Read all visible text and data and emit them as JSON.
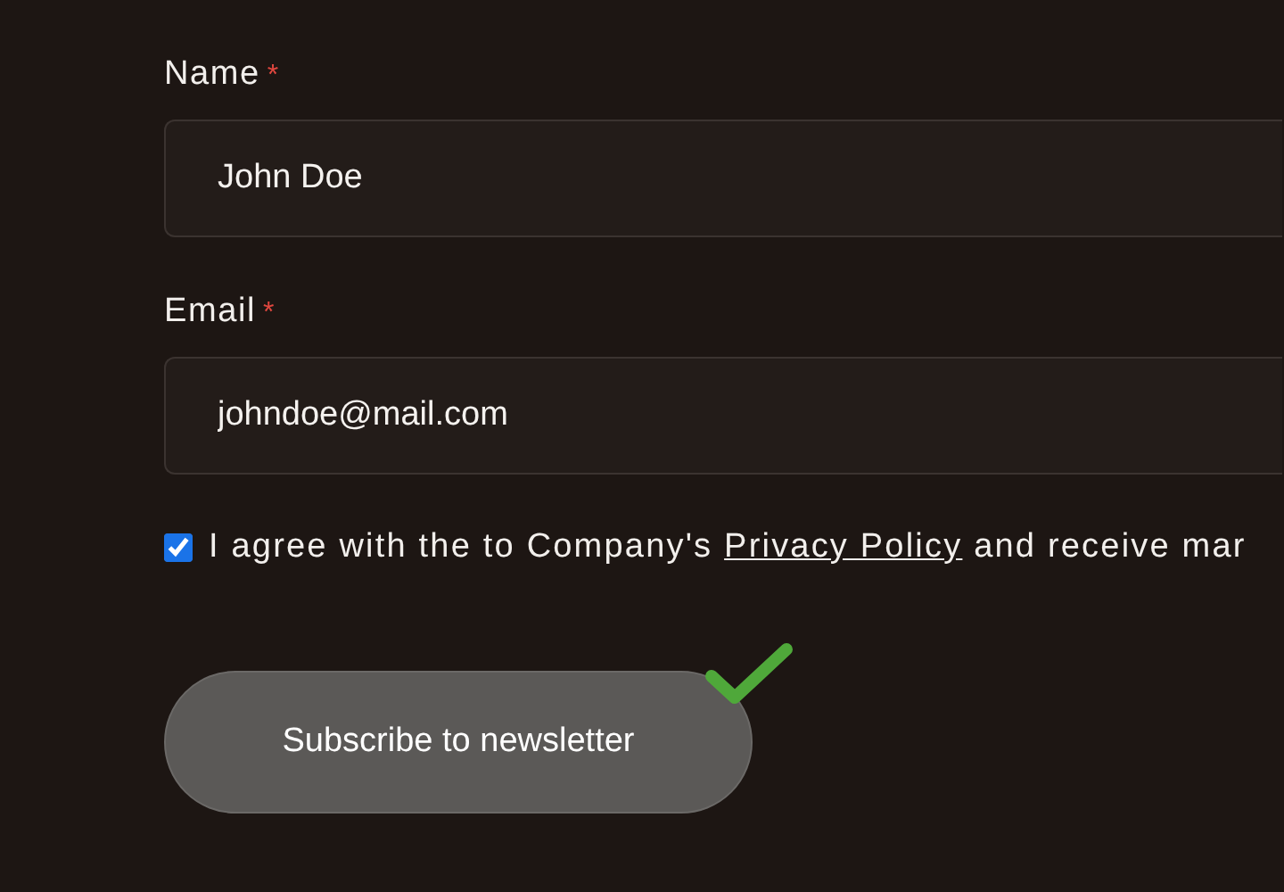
{
  "fields": [
    {
      "label": "Name",
      "required_mark": "*",
      "value": "John Doe"
    },
    {
      "label": "Email",
      "required_mark": "*",
      "value": "johndoe@mail.com"
    }
  ],
  "consent": {
    "checked": true,
    "text_before": "I agree with the to Company's ",
    "link": "Privacy Policy",
    "text_after": " and receive mar"
  },
  "submit": {
    "label": "Subscribe to newsletter",
    "done": true
  }
}
